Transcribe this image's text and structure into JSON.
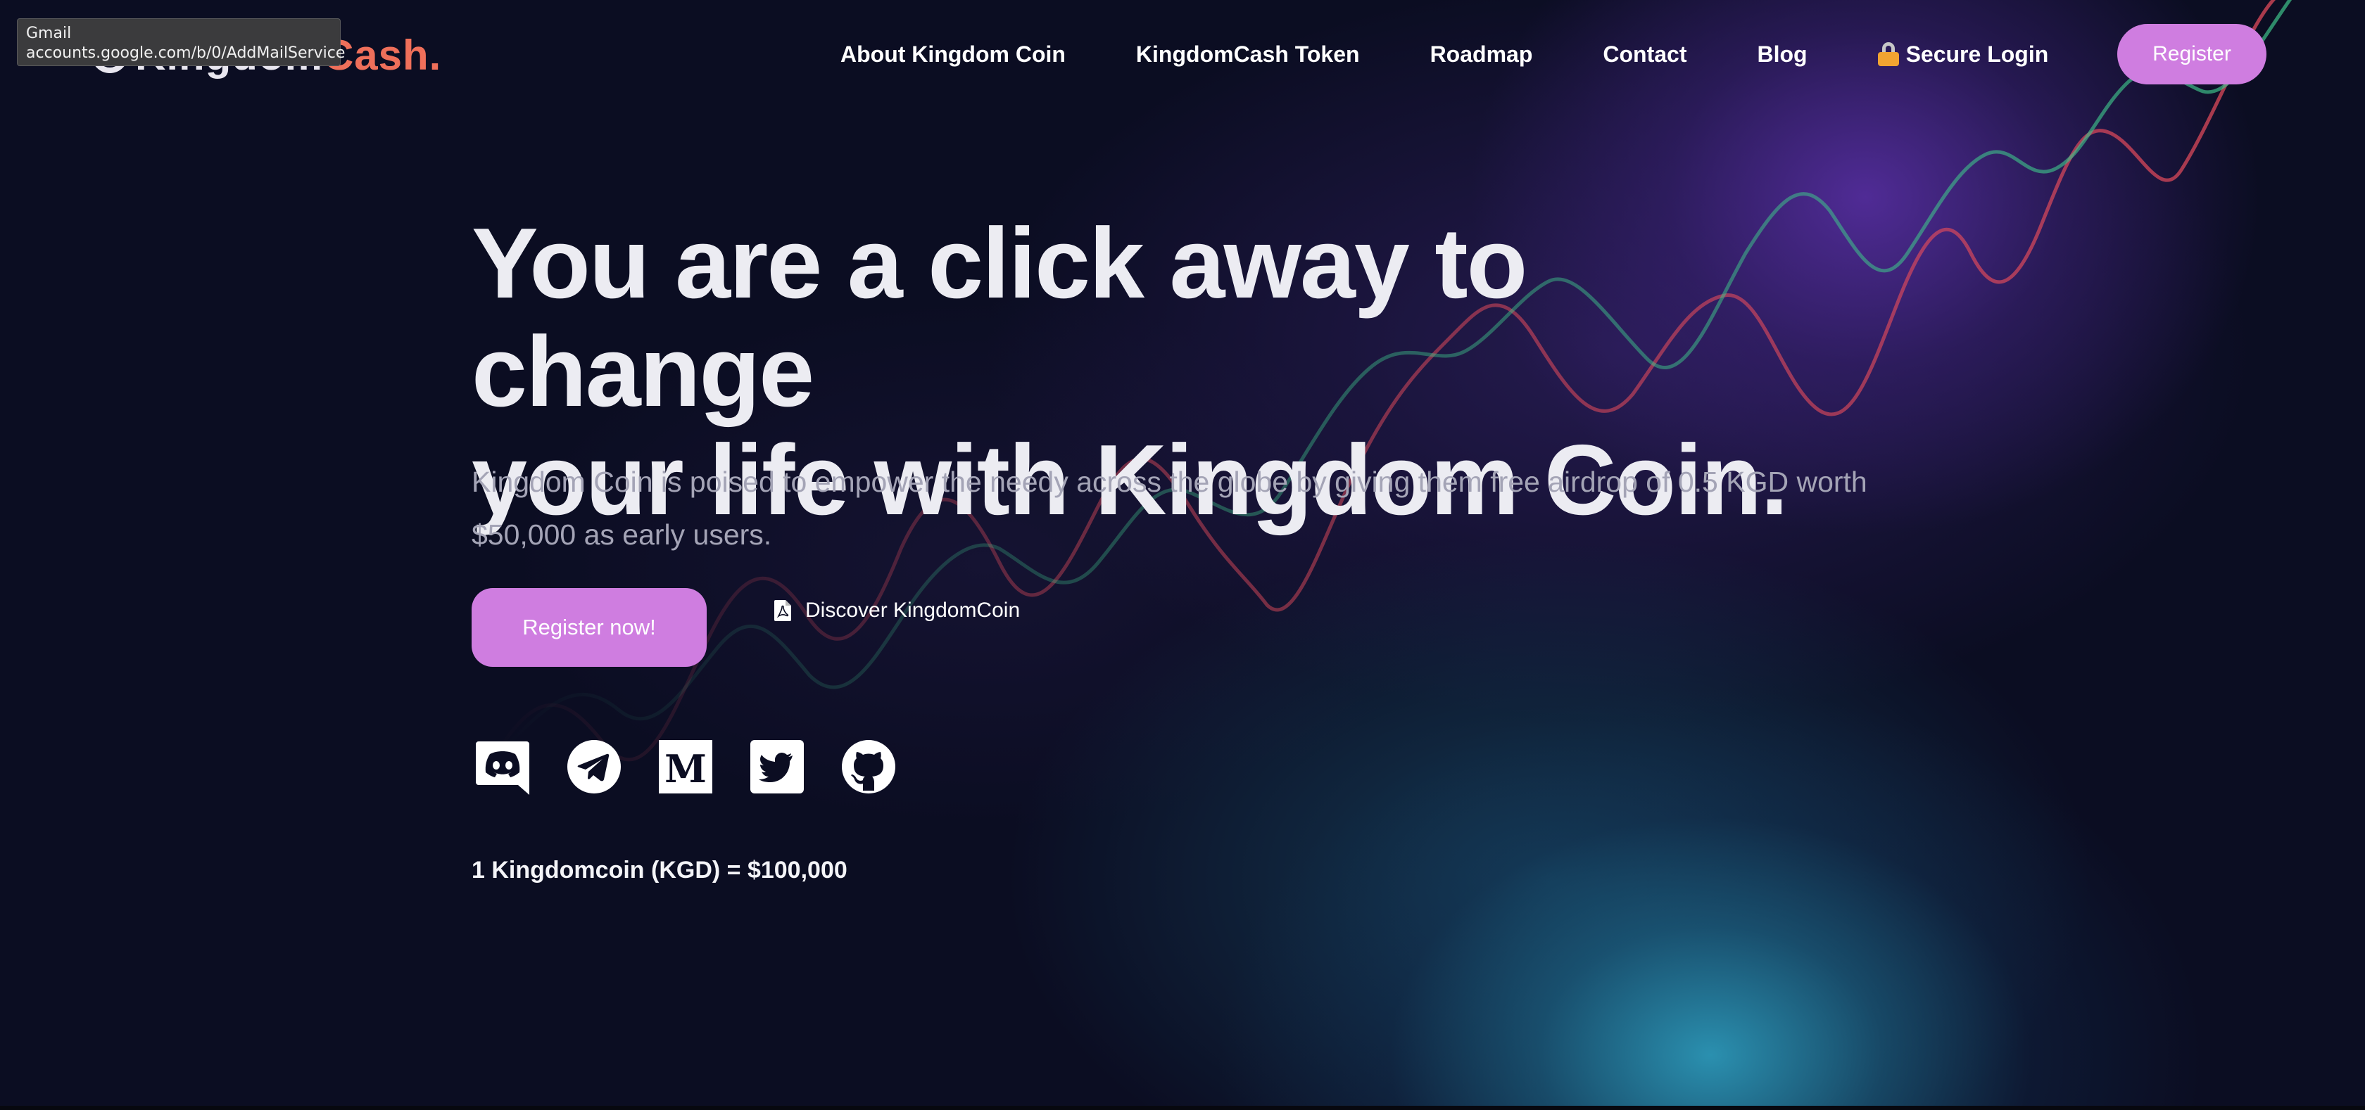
{
  "tooltip": {
    "title": "Gmail",
    "url": "accounts.google.com/b/0/AddMailService"
  },
  "logo": {
    "part_a": "Kingdom",
    "part_b": "Cash."
  },
  "nav": {
    "items": [
      {
        "label": "About Kingdom Coin"
      },
      {
        "label": "KingdomCash Token"
      },
      {
        "label": "Roadmap"
      },
      {
        "label": "Contact"
      },
      {
        "label": "Blog"
      },
      {
        "label": "Secure Login",
        "icon": "lock-icon"
      }
    ],
    "register_label": "Register"
  },
  "hero": {
    "title_line1": "You are a click away to change",
    "title_line2": "your life with Kingdom Coin.",
    "subtitle_line1": "Kingdom Coin is poised to empower the needy across the globe by giving them free airdrop of 0.5 KGD worth",
    "subtitle_line2": "$50,000 as early users.",
    "cta_label": "Register now!",
    "discover_label": "Discover KingdomCoin",
    "discover_icon": "pdf-file-icon"
  },
  "social": [
    {
      "name": "discord",
      "icon": "discord-icon"
    },
    {
      "name": "telegram",
      "icon": "telegram-icon"
    },
    {
      "name": "medium",
      "icon": "medium-icon"
    },
    {
      "name": "twitter",
      "icon": "twitter-icon"
    },
    {
      "name": "github",
      "icon": "github-icon"
    }
  ],
  "price": "1 Kingdomcoin (KGD) = $100,000",
  "colors": {
    "accent": "#cf7de0",
    "background": "#0b0d22",
    "logo_accent": "#ef6f5a",
    "teal_glow": "#2c96b6",
    "purple_glow": "#562ea0"
  }
}
